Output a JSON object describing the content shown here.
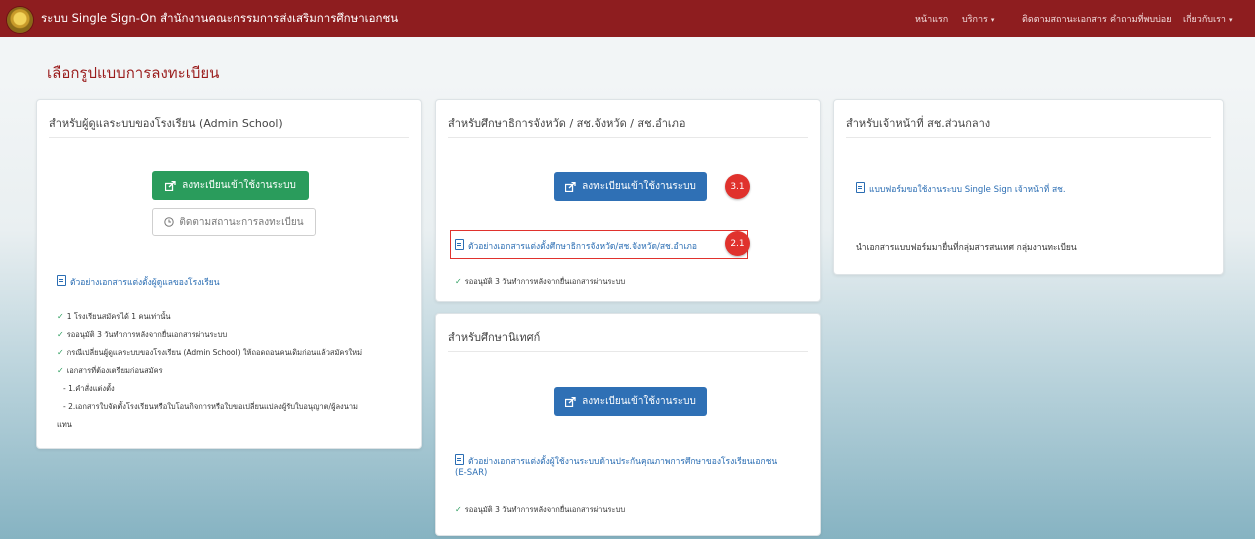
{
  "navbar": {
    "brand": "ระบบ Single Sign-On สำนักงานคณะกรรมการส่งเสริมการศึกษาเอกชน",
    "links": [
      {
        "label": "หน้าแรก",
        "caret": ""
      },
      {
        "label": "บริการ",
        "caret": "▾"
      },
      {
        "label": "ติดตามสถานะเอกสาร",
        "caret": ""
      },
      {
        "label": "คำถามที่พบบ่อย",
        "caret": ""
      },
      {
        "label": "เกี่ยวกับเรา",
        "caret": "▾"
      }
    ]
  },
  "page_title": "เลือกรูปแบบการลงทะเบียน",
  "admin_school": {
    "heading": "สำหรับผู้ดูแลระบบของโรงเรียน (Admin School)",
    "register_button": "ลงทะเบียนเข้าใช้งานระบบ",
    "track_button": "ติดตามสถานะการลงทะเบียน",
    "doc_link": "ตัวอย่างเอกสารแต่งตั้งผู้ดูแลของโรงเรียน",
    "notes": [
      "1 โรงเรียนสมัครได้ 1 คนเท่านั้น",
      "รออนุมัติ 3 วันทำการหลังจากยื่นเอกสารผ่านระบบ",
      "กรณีเปลี่ยนผู้ดูแลระบบของโรงเรียน (Admin School) ให้ถอดถอนคนเดิมก่อนแล้วสมัครใหม่",
      "เอกสารที่ต้องเตรียมก่อนสมัคร"
    ],
    "sub_notes": [
      "- 1.คำสั่งแต่งตั้ง",
      "- 2.เอกสารใบจัดตั้งโรงเรียนหรือใบโอนกิจการหรือใบขอเปลี่ยนแปลงผู้รับใบอนุญาต/ผู้ลงนาม",
      "แทน"
    ]
  },
  "province": {
    "heading": "สำหรับศึกษาธิการจังหวัด / สช.จังหวัด / สช.อำเภอ",
    "register_button": "ลงทะเบียนเข้าใช้งานระบบ",
    "badge_register": "3.1",
    "doc_link": "ตัวอย่างเอกสารแต่งตั้งศึกษาธิการจังหวัด/สช.จังหวัด/สช.อำเภอ",
    "badge_doc": "2.1",
    "note": "รออนุมัติ 3 วันทำการหลังจากยื่นเอกสารผ่านระบบ"
  },
  "supervisor": {
    "heading": "สำหรับศึกษานิเทศก์",
    "register_button": "ลงทะเบียนเข้าใช้งานระบบ",
    "doc_link_line1": "ตัวอย่างเอกสารแต่งตั้งผู้ใช้งานระบบด้านประกันคุณภาพการศึกษาของโรงเรียนเอกชน",
    "doc_link_line2": "(E-SAR)",
    "note": "รออนุมัติ 3 วันทำการหลังจากยื่นเอกสารผ่านระบบ"
  },
  "central": {
    "heading": "สำหรับเจ้าหน้าที่ สช.ส่วนกลาง",
    "doc_link": "แบบฟอร์มขอใช้งานระบบ Single Sign เจ้าหน้าที่ สช.",
    "text": "นำเอกสารแบบฟอร์มมายื่นที่กลุ่มสารสนเทศ กลุ่มงานทะเบียน"
  },
  "colors": {
    "navbar": "#8e1d1f",
    "green_button": "#2a9c5c",
    "blue_button": "#2f70b5",
    "badge": "#e0322d",
    "link": "#2a6db3"
  },
  "icons": {
    "register": "external-link-icon",
    "track": "clock-icon",
    "document": "document-icon",
    "check": "check-icon"
  }
}
